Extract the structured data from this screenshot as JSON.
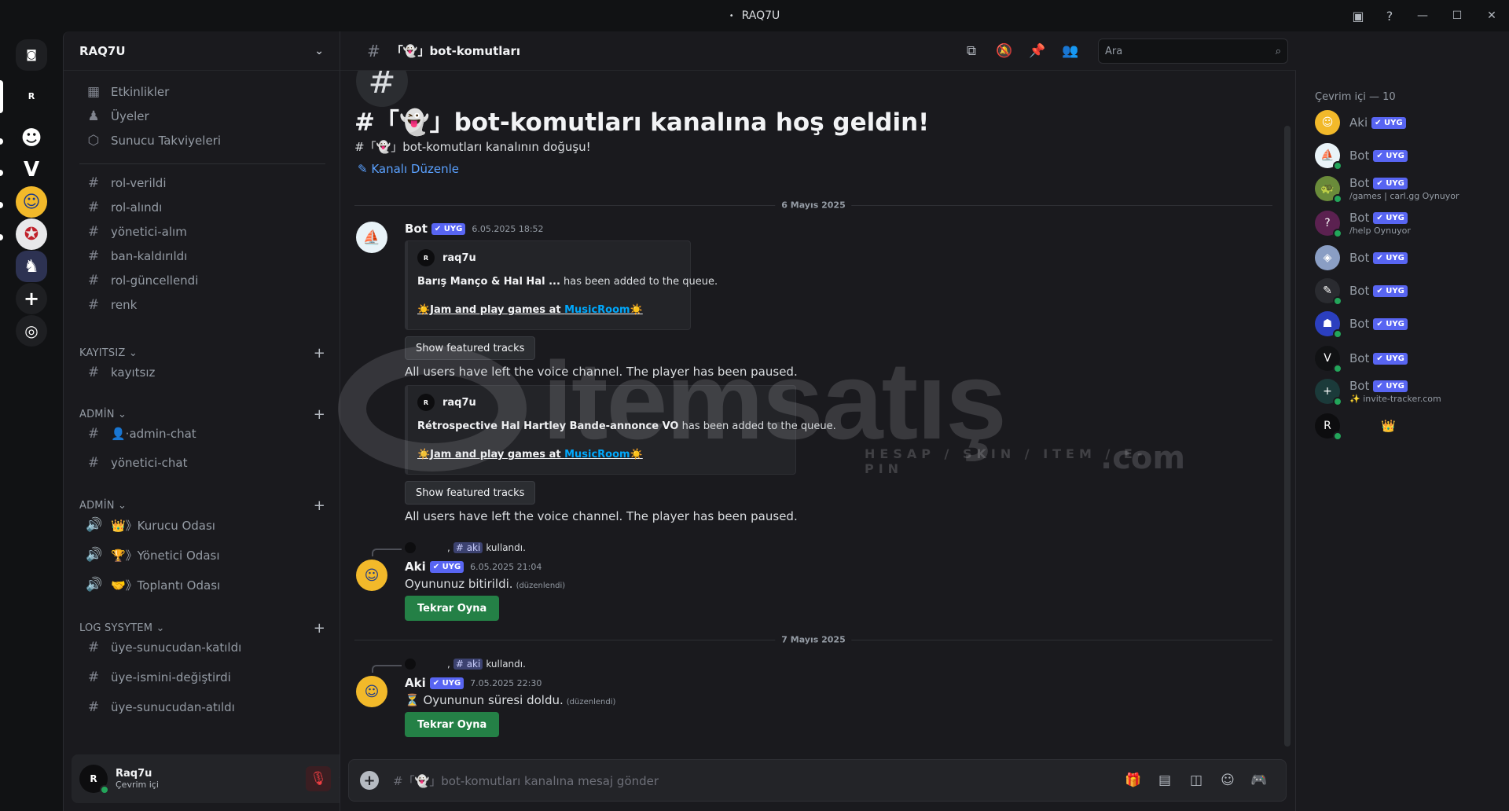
{
  "window": {
    "title": "RAQ7U",
    "title_prefix": "•"
  },
  "servers": [
    {
      "id": "home",
      "label": "",
      "color": "#1e1f22",
      "glyph": "◙"
    },
    {
      "id": "r",
      "label": "R",
      "color": "#111214",
      "glyph": "R"
    },
    {
      "id": "chat",
      "label": "",
      "color": "#111214",
      "glyph": "☻"
    },
    {
      "id": "valorant",
      "label": "",
      "color": "#111214",
      "glyph": "V"
    },
    {
      "id": "aki",
      "label": "",
      "color": "#f2b92a",
      "glyph": "☺"
    },
    {
      "id": "scarlet",
      "label": "",
      "color": "#e8e8ea",
      "glyph": "✪"
    },
    {
      "id": "ninja",
      "label": "",
      "color": "#2d3252",
      "glyph": "♞"
    },
    {
      "id": "add",
      "label": "",
      "color": "#1e1f22",
      "glyph": "+"
    },
    {
      "id": "discover",
      "label": "",
      "color": "#1e1f22",
      "glyph": "◎"
    }
  ],
  "sidebar": {
    "guild_name": "RAQ7U",
    "top_items": [
      {
        "label": "Etkinlikler",
        "icon": "calendar-icon",
        "glyph": "▦"
      },
      {
        "label": "Üyeler",
        "icon": "members-icon",
        "glyph": "👥"
      },
      {
        "label": "Sunucu Takviyeleri",
        "icon": "boost-icon",
        "glyph": "⬡"
      }
    ],
    "channels_a": [
      "rol-verildi",
      "rol-alındı",
      "yönetici-alım",
      "ban-kaldırıldı",
      "rol-güncellendi",
      "renk"
    ],
    "cat_kayitsiz": "KAYITSIZ",
    "channels_b": [
      "kayıtsız"
    ],
    "cat_admin1": "ADMİN",
    "channels_c": [
      {
        "label": "👤·admin-chat",
        "glyph": "#"
      },
      {
        "label": "yönetici-chat",
        "glyph": "#"
      }
    ],
    "cat_admin2": "ADMİN",
    "voice": [
      "👑》Kurucu Odası",
      "🏆》Yönetici Odası",
      "🤝》Toplantı Odası"
    ],
    "cat_log": "LOG SYSYTEM",
    "channels_d": [
      "üye-sunucudan-katıldı",
      "üye-ismini-değiştirdi",
      "üye-sunucudan-atıldı"
    ]
  },
  "user_panel": {
    "avatar_text": "R",
    "name": "Raq7u",
    "status": "Çevrim içi"
  },
  "chat": {
    "channel_name": "「👻」bot-komutları",
    "search_placeholder": "Ara",
    "welcome_title": "#「👻」bot-komutları kanalına hoş geldin!",
    "welcome_sub": "#「👻」bot-komutları kanalının doğuşu!",
    "edit_channel": "Kanalı Düzenle",
    "date1": "6 Mayıs 2025",
    "date2": "7 Mayıs 2025",
    "msg1": {
      "author": "Bot",
      "badge": "✔ UYG",
      "time": "6.05.2025 18:52",
      "embed1": {
        "author": "raq7u",
        "title": "Barış Manço & Hal Hal ...",
        "rest": " has been added to the queue.",
        "promo_a": "☀️Jam and play games at ",
        "promo_link": "MusicRoom",
        "promo_b": "☀️"
      },
      "button1": "Show featured tracks",
      "text1": "All users have left the voice channel. The player has been paused.",
      "embed2": {
        "author": "raq7u",
        "title": "Rétrospective Hal Hartley Bande-annonce VO",
        "rest": " has been added to the queue.",
        "promo_a": "☀️Jam and play games at ",
        "promo_link": "MusicRoom",
        "promo_b": "☀️"
      },
      "button2": "Show featured tracks",
      "text2": "All users have left the voice channel. The player has been paused."
    },
    "msg2": {
      "reply_cmd": "# aki",
      "reply_used": "kullandı.",
      "author": "Aki",
      "badge": "✔ UYG",
      "time": "6.05.2025 21:04",
      "text": "Oyununuz bitirildi.",
      "edited": "(düzenlendi)",
      "button": "Tekrar Oyna"
    },
    "msg3": {
      "reply_cmd": "# aki",
      "reply_used": "kullandı.",
      "author": "Aki",
      "badge": "✔ UYG",
      "time": "7.05.2025 22:30",
      "text": "⏳ Oyununun süresi doldu.",
      "edited": "(düzenlendi)",
      "button": "Tekrar Oyna"
    },
    "composer_placeholder": "#「👻」bot-komutları kanalına mesaj gönder"
  },
  "members": {
    "header": "Çevrim içi — 10",
    "list": [
      {
        "name": "Aki",
        "badge": "✔ UYG",
        "activity": "",
        "bg": "#f2b92a",
        "glyph": "☺",
        "online": false
      },
      {
        "name": "Bot",
        "badge": "✔ UYG",
        "activity": "",
        "bg": "#e9f3f8",
        "glyph": "⛵",
        "online": true
      },
      {
        "name": "Bot",
        "badge": "✔ UYG",
        "activity": "/games | carl.gg Oynuyor",
        "bg": "#6a8b3a",
        "glyph": "🐢",
        "online": true
      },
      {
        "name": "Bot",
        "badge": "✔ UYG",
        "activity": "/help Oynuyor",
        "bg": "#5b2150",
        "glyph": "?",
        "online": true
      },
      {
        "name": "Bot",
        "badge": "✔ UYG",
        "activity": "",
        "bg": "#8a9ec4",
        "glyph": "◈",
        "online": false
      },
      {
        "name": "Bot",
        "badge": "✔ UYG",
        "activity": "",
        "bg": "#2a2b30",
        "glyph": "✎",
        "online": true
      },
      {
        "name": "Bot",
        "badge": "✔ UYG",
        "activity": "",
        "bg": "#2b3fbf",
        "glyph": "☗",
        "online": true
      },
      {
        "name": "Bot",
        "badge": "✔ UYG",
        "activity": "",
        "bg": "#111214",
        "glyph": "V",
        "online": true
      },
      {
        "name": "Bot",
        "badge": "✔ UYG",
        "activity": "✨ invite-tracker.com",
        "bg": "#1b3a3a",
        "glyph": "+",
        "online": true
      },
      {
        "name": "",
        "badge": "👑",
        "activity": "",
        "bg": "#0d0d0f",
        "glyph": "R",
        "online": true
      }
    ]
  },
  "watermark": {
    "brand": "itemsatış",
    "tagline": "HESAP / SKIN / ITEM / E-PIN",
    "suffix": ".com"
  }
}
